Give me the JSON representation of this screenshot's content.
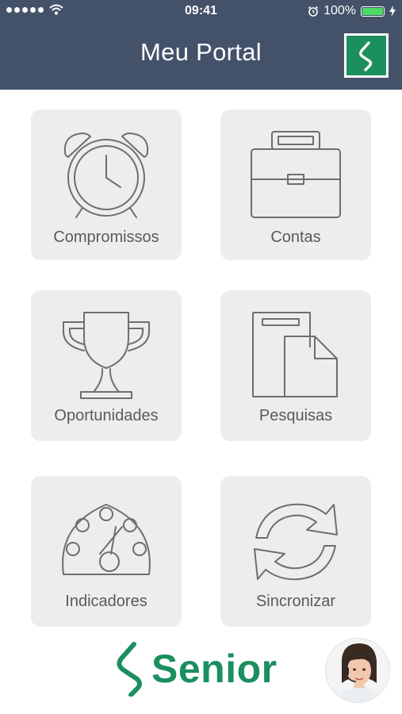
{
  "status_bar": {
    "time": "09:41",
    "battery": "100%",
    "battery_level": 1.0
  },
  "header": {
    "title": "Meu Portal",
    "logo_icon": "senior-logo-icon",
    "background": "#435169"
  },
  "tiles": [
    {
      "label": "Compromissos",
      "icon": "alarm-clock-icon"
    },
    {
      "label": "Contas",
      "icon": "briefcase-icon"
    },
    {
      "label": "Oportunidades",
      "icon": "trophy-icon"
    },
    {
      "label": "Pesquisas",
      "icon": "documents-icon"
    },
    {
      "label": "Indicadores",
      "icon": "gauge-icon"
    },
    {
      "label": "Sincronizar",
      "icon": "sync-icon"
    }
  ],
  "footer": {
    "brand": "Senior",
    "brand_color": "#1c8f5f",
    "support_avatar": "support-agent-avatar"
  }
}
